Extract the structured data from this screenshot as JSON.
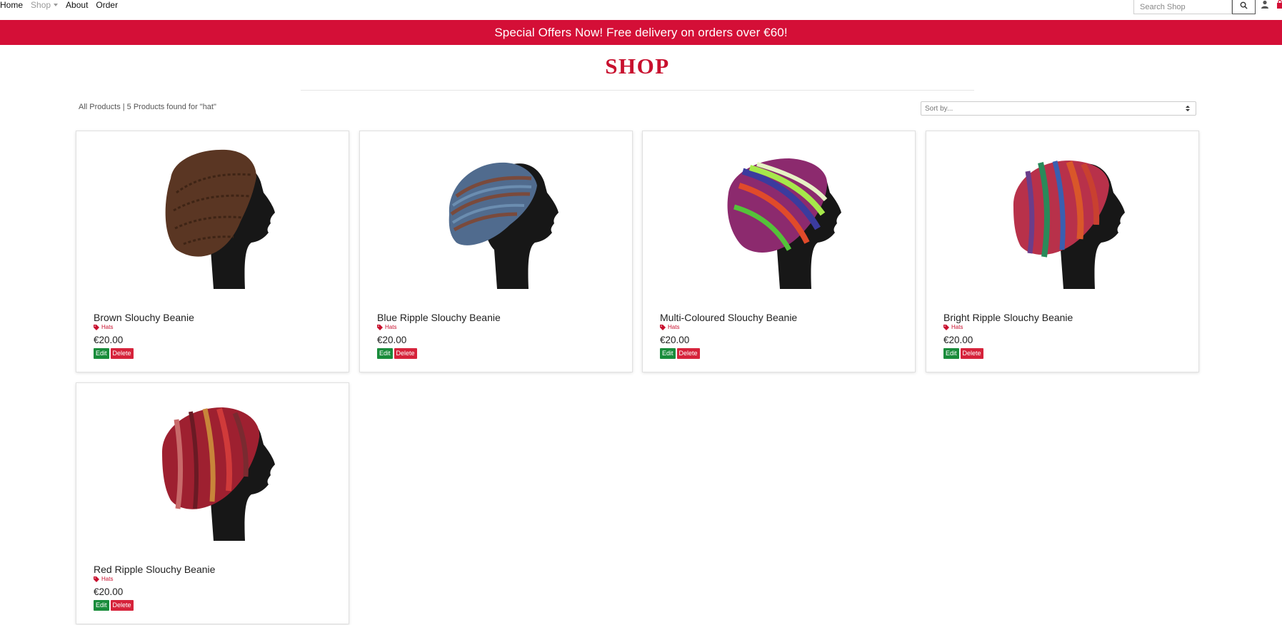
{
  "nav": {
    "home": "Home",
    "shop": "Shop",
    "about": "About",
    "order": "Order"
  },
  "search": {
    "placeholder": "Search Shop"
  },
  "banner": {
    "text": "Special Offers Now! Free delivery on orders over €60!"
  },
  "page": {
    "title": "SHOP",
    "all_products": "All Products",
    "results_text": " | 5 Products found for \"hat\"",
    "sort_placeholder": "Sort by..."
  },
  "colors": {
    "brand_red": "#d40f37",
    "edit_green": "#198c3b",
    "delete_red": "#d6233b"
  },
  "products": [
    {
      "name": "Brown Slouchy Beanie",
      "category": "Hats",
      "price": "€20.00",
      "edit": "Edit",
      "delete": "Delete",
      "image": "hat-brown"
    },
    {
      "name": "Blue Ripple Slouchy Beanie",
      "category": "Hats",
      "price": "€20.00",
      "edit": "Edit",
      "delete": "Delete",
      "image": "hat-blue"
    },
    {
      "name": "Multi-Coloured Slouchy Beanie",
      "category": "Hats",
      "price": "€20.00",
      "edit": "Edit",
      "delete": "Delete",
      "image": "hat-multi"
    },
    {
      "name": "Bright Ripple Slouchy Beanie",
      "category": "Hats",
      "price": "€20.00",
      "edit": "Edit",
      "delete": "Delete",
      "image": "hat-bright"
    },
    {
      "name": "Red Ripple Slouchy Beanie",
      "category": "Hats",
      "price": "€20.00",
      "edit": "Edit",
      "delete": "Delete",
      "image": "hat-red"
    }
  ]
}
